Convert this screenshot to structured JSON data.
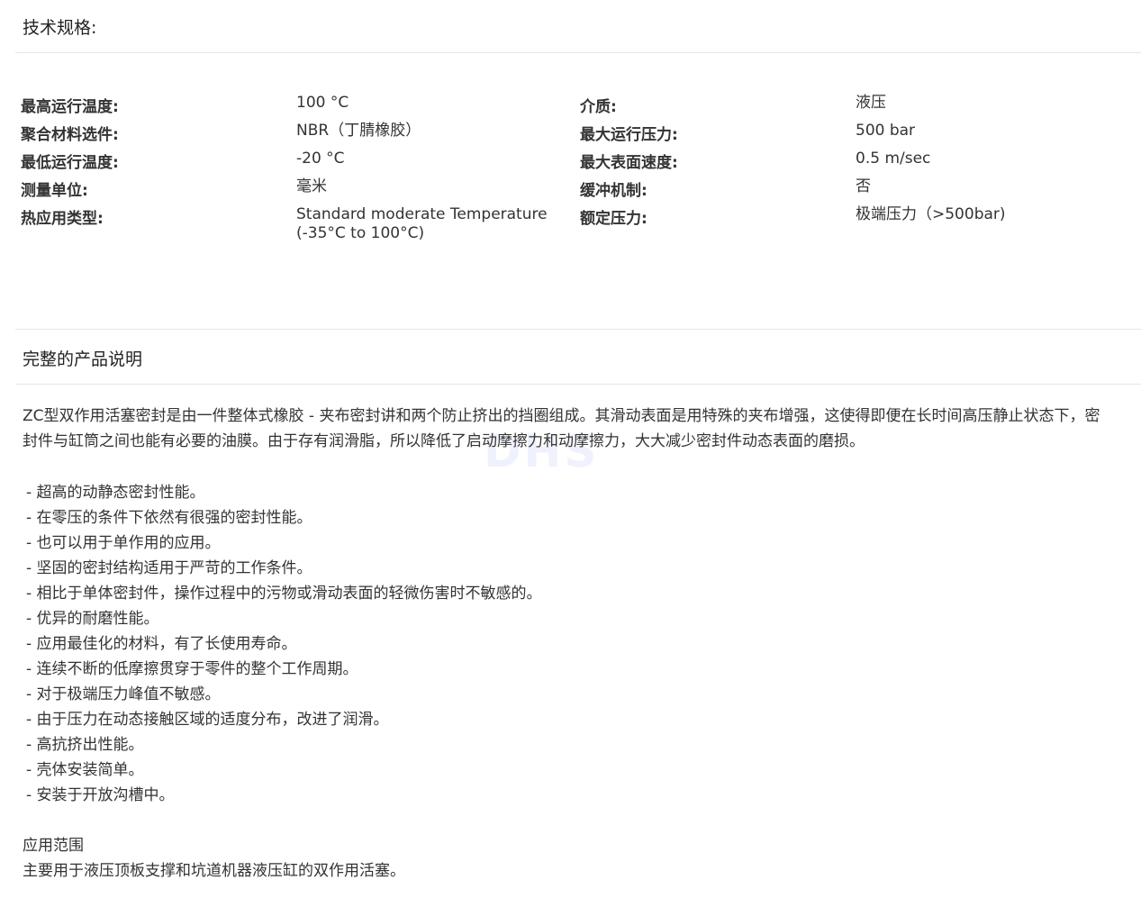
{
  "specs_section": {
    "title": "技术规格:",
    "left": [
      {
        "label": "最高运行温度:",
        "value": "100 °C"
      },
      {
        "label": "聚合材料选件:",
        "value": "NBR（丁腈橡胶）"
      },
      {
        "label": "最低运行温度:",
        "value": "-20 °C"
      },
      {
        "label": "测量单位:",
        "value": "毫米"
      },
      {
        "label": "热应用类型:",
        "value": "Standard moderate Temperature",
        "value2": "(-35°C to 100°C)"
      }
    ],
    "right": [
      {
        "label": "介质:",
        "value": "液压"
      },
      {
        "label": "最大运行压力:",
        "value": "500 bar"
      },
      {
        "label": "最大表面速度:",
        "value": "0.5 m/sec"
      },
      {
        "label": "缓冲机制:",
        "value": "否"
      },
      {
        "label": "额定压力:",
        "value": "极端压力（>500bar)"
      }
    ]
  },
  "description_section": {
    "title": "完整的产品说明",
    "paragraph_line1": "ZC型双作用活塞密封是由一件整体式橡胶 - 夹布密封讲和两个防止挤出的挡圈组成。其滑动表面是用特殊的夹布增强，这使得即便在长时间高压静止状态下，密",
    "paragraph_line2": "封件与缸筒之间也能有必要的油膜。由于存有润滑脂，所以降低了启动摩擦力和动摩擦力，大大减少密封件动态表面的磨损。",
    "watermark": "DHS",
    "features": [
      "- 超高的动静态密封性能。",
      "- 在零压的条件下依然有很强的密封性能。",
      "- 也可以用于单作用的应用。",
      "- 坚固的密封结构适用于严苛的工作条件。",
      "- 相比于单体密封件，操作过程中的污物或滑动表面的轻微伤害时不敏感的。",
      "- 优异的耐磨性能。",
      "- 应用最佳化的材料，有了长使用寿命。",
      "- 连续不断的低摩擦贯穿于零件的整个工作周期。",
      "- 对于极端压力峰值不敏感。",
      "- 由于压力在动态接触区域的适度分布，改进了润滑。",
      "- 高抗挤出性能。",
      "- 壳体安装简单。",
      "- 安装于开放沟槽中。"
    ],
    "application_heading": "应用范围",
    "application_text": "主要用于液压顶板支撑和坑道机器液压缸的双作用活塞。"
  }
}
